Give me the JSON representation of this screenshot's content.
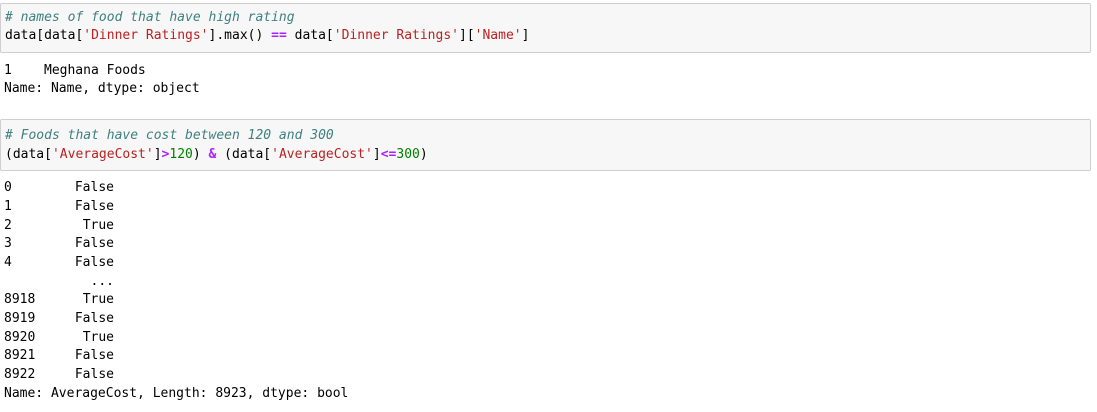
{
  "cell1": {
    "comment": "# names of food that have high rating",
    "code": {
      "p1": "data[data[",
      "s1": "'Dinner Ratings'",
      "p2": "].max() ",
      "op": "==",
      "p3": " data[",
      "s2": "'Dinner Ratings'",
      "p4": "][",
      "s3": "'Name'",
      "p5": "]"
    },
    "output": {
      "index": "1",
      "value": "Meghana Foods",
      "footer": "Name: Name, dtype: object"
    }
  },
  "cell2": {
    "comment": "# Foods that have cost between 120 and 300",
    "code": {
      "p1": "(data[",
      "s1": "'AverageCost'",
      "p2": "]",
      "op1": ">",
      "n1": "120",
      "p3": ") ",
      "op2": "&",
      "p4": " (data[",
      "s2": "'AverageCost'",
      "p5": "]",
      "op3": "<=",
      "n2": "300",
      "p6": ")"
    },
    "output": {
      "rows": [
        {
          "index": "0",
          "value": "False"
        },
        {
          "index": "1",
          "value": "False"
        },
        {
          "index": "2",
          "value": "True"
        },
        {
          "index": "3",
          "value": "False"
        },
        {
          "index": "4",
          "value": "False"
        },
        {
          "index": "",
          "value": "..."
        },
        {
          "index": "8918",
          "value": "True"
        },
        {
          "index": "8919",
          "value": "False"
        },
        {
          "index": "8920",
          "value": "True"
        },
        {
          "index": "8921",
          "value": "False"
        },
        {
          "index": "8922",
          "value": "False"
        }
      ],
      "footer": "Name: AverageCost, Length: 8923, dtype: bool"
    }
  },
  "colors": {
    "comment": "#408080",
    "string": "#ba2121",
    "operator": "#aa22ff",
    "number": "#008000",
    "cell_background": "#f7f7f7",
    "cell_border": "#cfcfcf"
  }
}
